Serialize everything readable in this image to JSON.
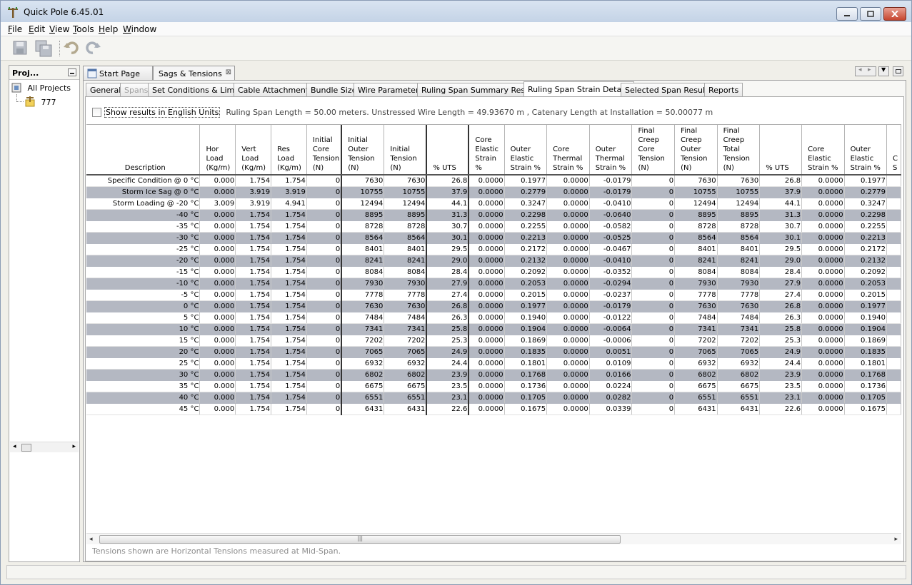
{
  "window": {
    "title": "Quick Pole 6.45.01"
  },
  "menu": {
    "items": [
      {
        "label": "File",
        "accel": "F",
        "rest": "ile"
      },
      {
        "label": "Edit",
        "accel": "E",
        "rest": "dit"
      },
      {
        "label": "View",
        "accel": "V",
        "rest": "iew"
      },
      {
        "label": "Tools",
        "accel": "T",
        "rest": "ools"
      },
      {
        "label": "Help",
        "accel": "H",
        "rest": "elp"
      },
      {
        "label": "Window",
        "accel": "W",
        "rest": "indow"
      }
    ]
  },
  "toolbar": {
    "icons": [
      "save-icon",
      "save-all-icon",
      "undo-icon",
      "redo-icon"
    ]
  },
  "projects_panel": {
    "title": "Proj...",
    "tree": [
      {
        "label": "All Projects",
        "icon": "projects-icon"
      },
      {
        "label": "777",
        "icon": "pole-icon"
      }
    ]
  },
  "doc_tabs": [
    {
      "label": "Start Page",
      "icon": "page-icon"
    },
    {
      "label": "Sags & Tensions",
      "active": true
    }
  ],
  "sub_tabs": [
    {
      "label": "General"
    },
    {
      "label": "Spans",
      "disabled": true
    },
    {
      "label": "Set Conditions & Limits"
    },
    {
      "label": "Cable Attachments"
    },
    {
      "label": "Bundle Size"
    },
    {
      "label": "Wire Parameters"
    },
    {
      "label": "Ruling Span Summary Results"
    },
    {
      "label": "Ruling Span Strain Details",
      "active": true
    },
    {
      "label": "Selected Span Results"
    },
    {
      "label": "Reports"
    }
  ],
  "options": {
    "english_units_label": "Show results in English Units",
    "english_units_checked": false,
    "info_text": "Ruling Span Length = 50.00 meters. Unstressed Wire Length = 49.93670 m , Catenary Length at Installation = 50.00077 m"
  },
  "table": {
    "columns": [
      {
        "label": "Description"
      },
      {
        "label": "Hor Load (Kg/m)"
      },
      {
        "label": "Vert Load (Kg/m)"
      },
      {
        "label": "Res Load (Kg/m)"
      },
      {
        "label": "Initial Core Tension (N)"
      },
      {
        "label": "Initial Outer Tension (N)"
      },
      {
        "label": "Initial Tension (N)"
      },
      {
        "label": "% UTS"
      },
      {
        "label": "Core Elastic Strain %"
      },
      {
        "label": "Outer Elastic Strain %"
      },
      {
        "label": "Core Thermal Strain %"
      },
      {
        "label": "Outer Thermal Strain %"
      },
      {
        "label": "Final Creep Core Tension (N)"
      },
      {
        "label": "Final Creep Outer Tension (N)"
      },
      {
        "label": "Final Creep Total Tension (N)"
      },
      {
        "label": "% UTS"
      },
      {
        "label": "Core Elastic Strain %"
      },
      {
        "label": "Outer Elastic Strain %"
      },
      {
        "label": "C S"
      }
    ],
    "rows": [
      [
        "Specific Condition @ 0 °C",
        "0.000",
        "1.754",
        "1.754",
        "0",
        "7630",
        "7630",
        "26.8",
        "0.0000",
        "0.1977",
        "0.0000",
        "-0.0179",
        "0",
        "7630",
        "7630",
        "26.8",
        "0.0000",
        "0.1977",
        ""
      ],
      [
        "Storm Ice Sag @ 0 °C",
        "0.000",
        "3.919",
        "3.919",
        "0",
        "10755",
        "10755",
        "37.9",
        "0.0000",
        "0.2779",
        "0.0000",
        "-0.0179",
        "0",
        "10755",
        "10755",
        "37.9",
        "0.0000",
        "0.2779",
        ""
      ],
      [
        "Storm Loading @ -20 °C",
        "3.009",
        "3.919",
        "4.941",
        "0",
        "12494",
        "12494",
        "44.1",
        "0.0000",
        "0.3247",
        "0.0000",
        "-0.0410",
        "0",
        "12494",
        "12494",
        "44.1",
        "0.0000",
        "0.3247",
        ""
      ],
      [
        "-40 °C",
        "0.000",
        "1.754",
        "1.754",
        "0",
        "8895",
        "8895",
        "31.3",
        "0.0000",
        "0.2298",
        "0.0000",
        "-0.0640",
        "0",
        "8895",
        "8895",
        "31.3",
        "0.0000",
        "0.2298",
        ""
      ],
      [
        "-35 °C",
        "0.000",
        "1.754",
        "1.754",
        "0",
        "8728",
        "8728",
        "30.7",
        "0.0000",
        "0.2255",
        "0.0000",
        "-0.0582",
        "0",
        "8728",
        "8728",
        "30.7",
        "0.0000",
        "0.2255",
        ""
      ],
      [
        "-30 °C",
        "0.000",
        "1.754",
        "1.754",
        "0",
        "8564",
        "8564",
        "30.1",
        "0.0000",
        "0.2213",
        "0.0000",
        "-0.0525",
        "0",
        "8564",
        "8564",
        "30.1",
        "0.0000",
        "0.2213",
        ""
      ],
      [
        "-25 °C",
        "0.000",
        "1.754",
        "1.754",
        "0",
        "8401",
        "8401",
        "29.5",
        "0.0000",
        "0.2172",
        "0.0000",
        "-0.0467",
        "0",
        "8401",
        "8401",
        "29.5",
        "0.0000",
        "0.2172",
        ""
      ],
      [
        "-20 °C",
        "0.000",
        "1.754",
        "1.754",
        "0",
        "8241",
        "8241",
        "29.0",
        "0.0000",
        "0.2132",
        "0.0000",
        "-0.0410",
        "0",
        "8241",
        "8241",
        "29.0",
        "0.0000",
        "0.2132",
        ""
      ],
      [
        "-15 °C",
        "0.000",
        "1.754",
        "1.754",
        "0",
        "8084",
        "8084",
        "28.4",
        "0.0000",
        "0.2092",
        "0.0000",
        "-0.0352",
        "0",
        "8084",
        "8084",
        "28.4",
        "0.0000",
        "0.2092",
        ""
      ],
      [
        "-10 °C",
        "0.000",
        "1.754",
        "1.754",
        "0",
        "7930",
        "7930",
        "27.9",
        "0.0000",
        "0.2053",
        "0.0000",
        "-0.0294",
        "0",
        "7930",
        "7930",
        "27.9",
        "0.0000",
        "0.2053",
        ""
      ],
      [
        "-5 °C",
        "0.000",
        "1.754",
        "1.754",
        "0",
        "7778",
        "7778",
        "27.4",
        "0.0000",
        "0.2015",
        "0.0000",
        "-0.0237",
        "0",
        "7778",
        "7778",
        "27.4",
        "0.0000",
        "0.2015",
        ""
      ],
      [
        "0 °C",
        "0.000",
        "1.754",
        "1.754",
        "0",
        "7630",
        "7630",
        "26.8",
        "0.0000",
        "0.1977",
        "0.0000",
        "-0.0179",
        "0",
        "7630",
        "7630",
        "26.8",
        "0.0000",
        "0.1977",
        ""
      ],
      [
        "5 °C",
        "0.000",
        "1.754",
        "1.754",
        "0",
        "7484",
        "7484",
        "26.3",
        "0.0000",
        "0.1940",
        "0.0000",
        "-0.0122",
        "0",
        "7484",
        "7484",
        "26.3",
        "0.0000",
        "0.1940",
        ""
      ],
      [
        "10 °C",
        "0.000",
        "1.754",
        "1.754",
        "0",
        "7341",
        "7341",
        "25.8",
        "0.0000",
        "0.1904",
        "0.0000",
        "-0.0064",
        "0",
        "7341",
        "7341",
        "25.8",
        "0.0000",
        "0.1904",
        ""
      ],
      [
        "15 °C",
        "0.000",
        "1.754",
        "1.754",
        "0",
        "7202",
        "7202",
        "25.3",
        "0.0000",
        "0.1869",
        "0.0000",
        "-0.0006",
        "0",
        "7202",
        "7202",
        "25.3",
        "0.0000",
        "0.1869",
        ""
      ],
      [
        "20 °C",
        "0.000",
        "1.754",
        "1.754",
        "0",
        "7065",
        "7065",
        "24.9",
        "0.0000",
        "0.1835",
        "0.0000",
        "0.0051",
        "0",
        "7065",
        "7065",
        "24.9",
        "0.0000",
        "0.1835",
        ""
      ],
      [
        "25 °C",
        "0.000",
        "1.754",
        "1.754",
        "0",
        "6932",
        "6932",
        "24.4",
        "0.0000",
        "0.1801",
        "0.0000",
        "0.0109",
        "0",
        "6932",
        "6932",
        "24.4",
        "0.0000",
        "0.1801",
        ""
      ],
      [
        "30 °C",
        "0.000",
        "1.754",
        "1.754",
        "0",
        "6802",
        "6802",
        "23.9",
        "0.0000",
        "0.1768",
        "0.0000",
        "0.0166",
        "0",
        "6802",
        "6802",
        "23.9",
        "0.0000",
        "0.1768",
        ""
      ],
      [
        "35 °C",
        "0.000",
        "1.754",
        "1.754",
        "0",
        "6675",
        "6675",
        "23.5",
        "0.0000",
        "0.1736",
        "0.0000",
        "0.0224",
        "0",
        "6675",
        "6675",
        "23.5",
        "0.0000",
        "0.1736",
        ""
      ],
      [
        "40 °C",
        "0.000",
        "1.754",
        "1.754",
        "0",
        "6551",
        "6551",
        "23.1",
        "0.0000",
        "0.1705",
        "0.0000",
        "0.0282",
        "0",
        "6551",
        "6551",
        "23.1",
        "0.0000",
        "0.1705",
        ""
      ],
      [
        "45 °C",
        "0.000",
        "1.754",
        "1.754",
        "0",
        "6431",
        "6431",
        "22.6",
        "0.0000",
        "0.1675",
        "0.0000",
        "0.0339",
        "0",
        "6431",
        "6431",
        "22.6",
        "0.0000",
        "0.1675",
        ""
      ]
    ]
  },
  "footer_note": "Tensions shown are Horizontal Tensions measured at Mid-Span.",
  "colors": {
    "alt_row": "#b4b8c2",
    "close_button": "#c6452f",
    "titlebar": "#c4d3e6"
  }
}
